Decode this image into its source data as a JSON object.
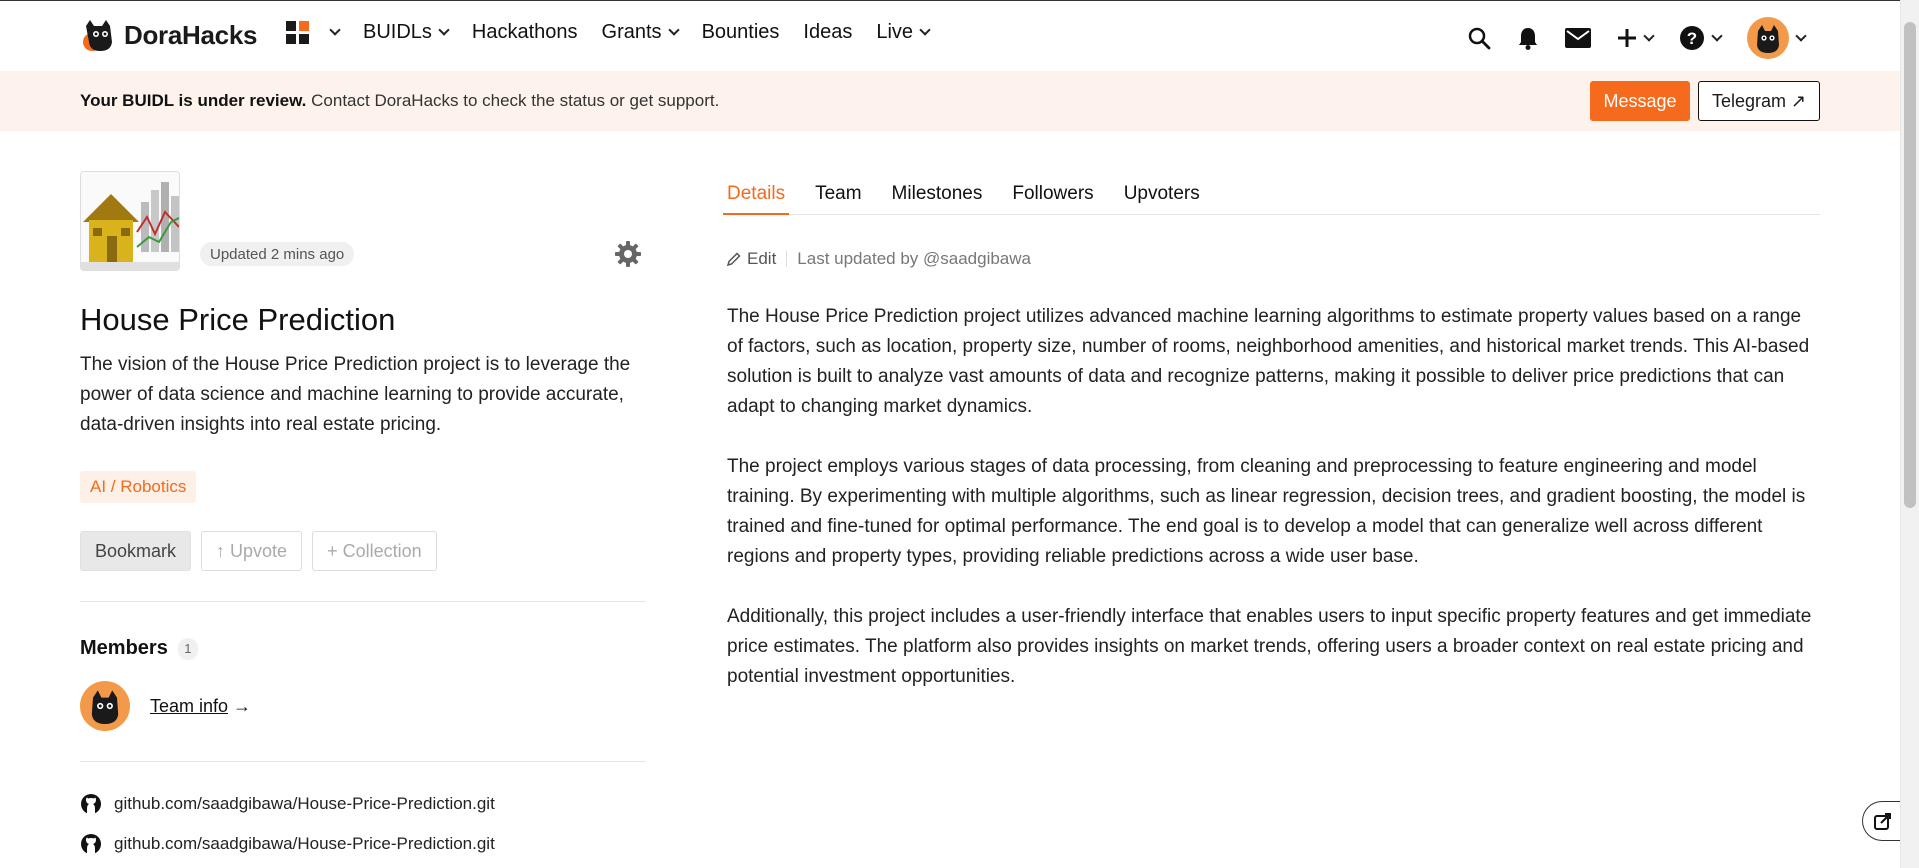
{
  "app": {
    "brand": "DoraHacks"
  },
  "nav": {
    "items": [
      {
        "label": "BUIDLs",
        "has_menu": true
      },
      {
        "label": "Hackathons",
        "has_menu": false
      },
      {
        "label": "Grants",
        "has_menu": true
      },
      {
        "label": "Bounties",
        "has_menu": false
      },
      {
        "label": "Ideas",
        "has_menu": false
      },
      {
        "label": "Live",
        "has_menu": true
      }
    ]
  },
  "icons": {
    "search": "search-icon",
    "bell": "bell-icon",
    "mail": "mail-icon",
    "plus": "plus-icon",
    "help": "help-icon"
  },
  "banner": {
    "bold": "Your BUIDL is under review.",
    "text": " Contact DoraHacks to check the status or get support.",
    "message_label": "Message",
    "telegram_label": "Telegram ↗"
  },
  "project": {
    "updated": "Updated 2 mins ago",
    "title": "House Price Prediction",
    "vision": "The vision of the House Price Prediction project is to leverage the power of data science and machine learning to provide accurate, data-driven insights into real estate pricing.",
    "tag": "AI / Robotics",
    "actions": {
      "bookmark": "Bookmark",
      "upvote": "↑ Upvote",
      "collection": "+ Collection"
    },
    "members_label": "Members",
    "members_count": "1",
    "team_info": "Team info",
    "team_arrow": " →",
    "repos": [
      "github.com/saadgibawa/House-Price-Prediction.git",
      "github.com/saadgibawa/House-Price-Prediction.git"
    ]
  },
  "tabs": [
    {
      "label": "Details",
      "active": true
    },
    {
      "label": "Team",
      "active": false
    },
    {
      "label": "Milestones",
      "active": false
    },
    {
      "label": "Followers",
      "active": false
    },
    {
      "label": "Upvoters",
      "active": false
    }
  ],
  "details": {
    "edit_label": "Edit",
    "last_updated": "Last updated by @saadgibawa",
    "paragraphs": [
      "The House Price Prediction project utilizes advanced machine learning algorithms to estimate property values based on a range of factors, such as location, property size, number of rooms, neighborhood amenities, and historical market trends. This AI-based solution is built to analyze vast amounts of data and recognize patterns, making it possible to deliver price predictions that can adapt to changing market dynamics.",
      "The project employs various stages of data processing, from cleaning and preprocessing to feature engineering and model training. By experimenting with multiple algorithms, such as linear regression, decision trees, and gradient boosting, the model is trained and fine-tuned for optimal performance. The end goal is to develop a model that can generalize well across different regions and property types, providing reliable predictions across a wide user base.",
      "Additionally, this project includes a user-friendly interface that enables users to input specific property features and get immediate price estimates. The platform also provides insights on market trends, offering users a broader context on real estate pricing and potential investment opportunities."
    ]
  },
  "colors": {
    "accent": "#f56a1c",
    "banner_bg": "#fdf3ec",
    "avatar_bg": "#f39a4a"
  }
}
